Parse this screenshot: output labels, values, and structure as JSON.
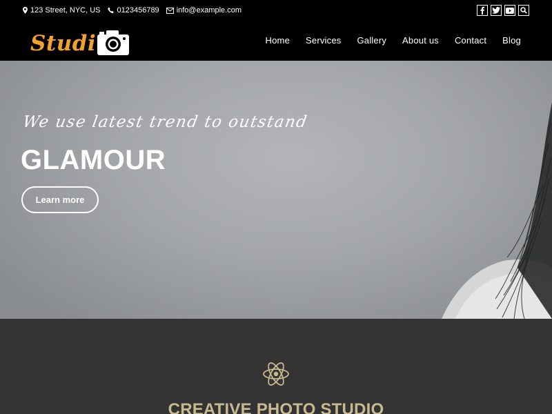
{
  "topbar": {
    "address": "123 Street, NYC, US",
    "phone": "0123456789",
    "email": "info@example.com",
    "socials": [
      "facebook-icon",
      "twitter-icon",
      "youtube-icon",
      "search-icon"
    ]
  },
  "header": {
    "logo_text": "Studi",
    "nav": [
      "Home",
      "Services",
      "Gallery",
      "About us",
      "Contact",
      "Blog"
    ]
  },
  "hero": {
    "tagline": "We use latest trend to outstand",
    "title": "GLAMOUR",
    "button_label": "Learn more"
  },
  "section": {
    "icon": "atom-icon",
    "title": "CREATIVE PHOTO STUDIO"
  },
  "colors": {
    "brand_orange": "#f2a12b",
    "section_bg": "#333333",
    "section_title": "#c9b98f"
  }
}
